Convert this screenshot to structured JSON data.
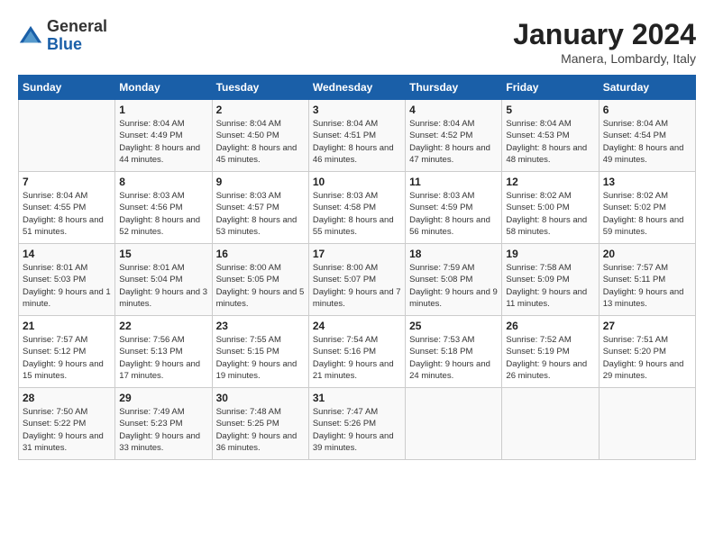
{
  "header": {
    "logo": {
      "general": "General",
      "blue": "Blue"
    },
    "title": "January 2024",
    "subtitle": "Manera, Lombardy, Italy"
  },
  "calendar": {
    "days_of_week": [
      "Sunday",
      "Monday",
      "Tuesday",
      "Wednesday",
      "Thursday",
      "Friday",
      "Saturday"
    ],
    "weeks": [
      [
        {
          "day": "",
          "info": ""
        },
        {
          "day": "1",
          "info": "Sunrise: 8:04 AM\nSunset: 4:49 PM\nDaylight: 8 hours\nand 44 minutes."
        },
        {
          "day": "2",
          "info": "Sunrise: 8:04 AM\nSunset: 4:50 PM\nDaylight: 8 hours\nand 45 minutes."
        },
        {
          "day": "3",
          "info": "Sunrise: 8:04 AM\nSunset: 4:51 PM\nDaylight: 8 hours\nand 46 minutes."
        },
        {
          "day": "4",
          "info": "Sunrise: 8:04 AM\nSunset: 4:52 PM\nDaylight: 8 hours\nand 47 minutes."
        },
        {
          "day": "5",
          "info": "Sunrise: 8:04 AM\nSunset: 4:53 PM\nDaylight: 8 hours\nand 48 minutes."
        },
        {
          "day": "6",
          "info": "Sunrise: 8:04 AM\nSunset: 4:54 PM\nDaylight: 8 hours\nand 49 minutes."
        }
      ],
      [
        {
          "day": "7",
          "info": "Sunrise: 8:04 AM\nSunset: 4:55 PM\nDaylight: 8 hours\nand 51 minutes."
        },
        {
          "day": "8",
          "info": "Sunrise: 8:03 AM\nSunset: 4:56 PM\nDaylight: 8 hours\nand 52 minutes."
        },
        {
          "day": "9",
          "info": "Sunrise: 8:03 AM\nSunset: 4:57 PM\nDaylight: 8 hours\nand 53 minutes."
        },
        {
          "day": "10",
          "info": "Sunrise: 8:03 AM\nSunset: 4:58 PM\nDaylight: 8 hours\nand 55 minutes."
        },
        {
          "day": "11",
          "info": "Sunrise: 8:03 AM\nSunset: 4:59 PM\nDaylight: 8 hours\nand 56 minutes."
        },
        {
          "day": "12",
          "info": "Sunrise: 8:02 AM\nSunset: 5:00 PM\nDaylight: 8 hours\nand 58 minutes."
        },
        {
          "day": "13",
          "info": "Sunrise: 8:02 AM\nSunset: 5:02 PM\nDaylight: 8 hours\nand 59 minutes."
        }
      ],
      [
        {
          "day": "14",
          "info": "Sunrise: 8:01 AM\nSunset: 5:03 PM\nDaylight: 9 hours\nand 1 minute."
        },
        {
          "day": "15",
          "info": "Sunrise: 8:01 AM\nSunset: 5:04 PM\nDaylight: 9 hours\nand 3 minutes."
        },
        {
          "day": "16",
          "info": "Sunrise: 8:00 AM\nSunset: 5:05 PM\nDaylight: 9 hours\nand 5 minutes."
        },
        {
          "day": "17",
          "info": "Sunrise: 8:00 AM\nSunset: 5:07 PM\nDaylight: 9 hours\nand 7 minutes."
        },
        {
          "day": "18",
          "info": "Sunrise: 7:59 AM\nSunset: 5:08 PM\nDaylight: 9 hours\nand 9 minutes."
        },
        {
          "day": "19",
          "info": "Sunrise: 7:58 AM\nSunset: 5:09 PM\nDaylight: 9 hours\nand 11 minutes."
        },
        {
          "day": "20",
          "info": "Sunrise: 7:57 AM\nSunset: 5:11 PM\nDaylight: 9 hours\nand 13 minutes."
        }
      ],
      [
        {
          "day": "21",
          "info": "Sunrise: 7:57 AM\nSunset: 5:12 PM\nDaylight: 9 hours\nand 15 minutes."
        },
        {
          "day": "22",
          "info": "Sunrise: 7:56 AM\nSunset: 5:13 PM\nDaylight: 9 hours\nand 17 minutes."
        },
        {
          "day": "23",
          "info": "Sunrise: 7:55 AM\nSunset: 5:15 PM\nDaylight: 9 hours\nand 19 minutes."
        },
        {
          "day": "24",
          "info": "Sunrise: 7:54 AM\nSunset: 5:16 PM\nDaylight: 9 hours\nand 21 minutes."
        },
        {
          "day": "25",
          "info": "Sunrise: 7:53 AM\nSunset: 5:18 PM\nDaylight: 9 hours\nand 24 minutes."
        },
        {
          "day": "26",
          "info": "Sunrise: 7:52 AM\nSunset: 5:19 PM\nDaylight: 9 hours\nand 26 minutes."
        },
        {
          "day": "27",
          "info": "Sunrise: 7:51 AM\nSunset: 5:20 PM\nDaylight: 9 hours\nand 29 minutes."
        }
      ],
      [
        {
          "day": "28",
          "info": "Sunrise: 7:50 AM\nSunset: 5:22 PM\nDaylight: 9 hours\nand 31 minutes."
        },
        {
          "day": "29",
          "info": "Sunrise: 7:49 AM\nSunset: 5:23 PM\nDaylight: 9 hours\nand 33 minutes."
        },
        {
          "day": "30",
          "info": "Sunrise: 7:48 AM\nSunset: 5:25 PM\nDaylight: 9 hours\nand 36 minutes."
        },
        {
          "day": "31",
          "info": "Sunrise: 7:47 AM\nSunset: 5:26 PM\nDaylight: 9 hours\nand 39 minutes."
        },
        {
          "day": "",
          "info": ""
        },
        {
          "day": "",
          "info": ""
        },
        {
          "day": "",
          "info": ""
        }
      ]
    ]
  }
}
